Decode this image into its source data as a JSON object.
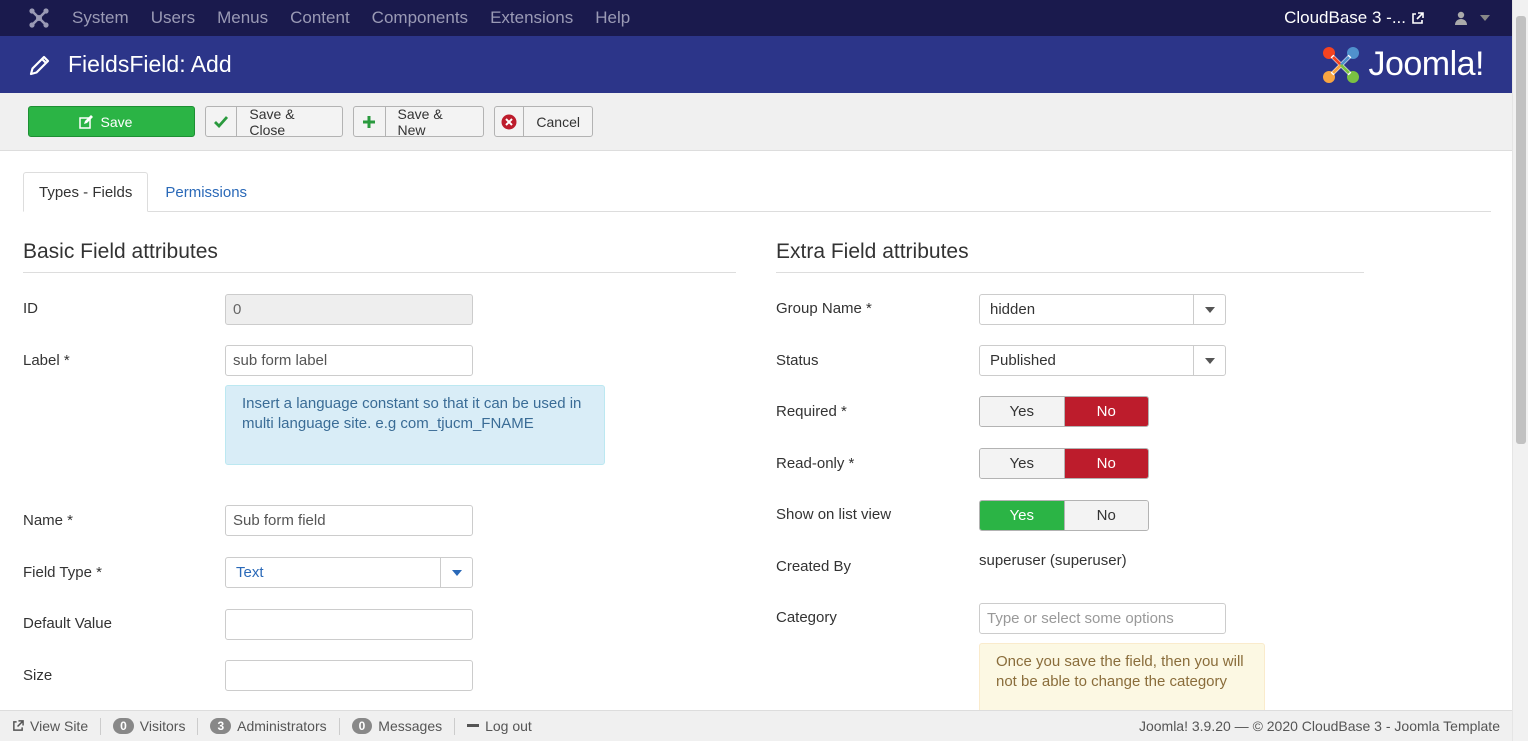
{
  "topnav": {
    "menu": [
      "System",
      "Users",
      "Menus",
      "Content",
      "Components",
      "Extensions",
      "Help"
    ],
    "site_name": "CloudBase 3 -..."
  },
  "header": {
    "title": "FieldsField: Add",
    "brand": "Joomla!"
  },
  "toolbar": {
    "save": "Save",
    "save_close": "Save & Close",
    "save_new": "Save & New",
    "cancel": "Cancel"
  },
  "tabs": [
    "Types - Fields",
    "Permissions"
  ],
  "basic": {
    "heading": "Basic Field attributes",
    "id_label": "ID",
    "id_value": "0",
    "label_label": "Label *",
    "label_value": "sub form label",
    "label_note": "Insert a language constant so that it can be used in multi language site. e.g com_tjucm_FNAME",
    "name_label": "Name *",
    "name_value": "Sub form field",
    "type_label": "Field Type *",
    "type_value": "Text",
    "default_label": "Default Value",
    "default_value": "",
    "size_label": "Size",
    "size_value": ""
  },
  "extra": {
    "heading": "Extra Field attributes",
    "group_label": "Group Name *",
    "group_value": "hidden",
    "status_label": "Status",
    "status_value": "Published",
    "required_label": "Required *",
    "readonly_label": "Read-only *",
    "showlist_label": "Show on list view",
    "yes": "Yes",
    "no": "No",
    "createdby_label": "Created By",
    "createdby_value": "superuser (superuser)",
    "category_label": "Category",
    "category_placeholder": "Type or select some options",
    "category_note": "Once you save the field, then you will not be able to change the category"
  },
  "statusbar": {
    "view_site": "View Site",
    "visitors_count": "0",
    "visitors": "Visitors",
    "admins_count": "3",
    "admins": "Administrators",
    "messages_count": "0",
    "messages": "Messages",
    "logout": "Log out",
    "footer": "Joomla! 3.9.20  —  © 2020 CloudBase 3 - Joomla Template"
  },
  "colors": {
    "nav_bg": "#1a1a4d",
    "header_bg": "#2c3589",
    "save_green": "#2bb445",
    "no_red": "#bd1c2c"
  }
}
